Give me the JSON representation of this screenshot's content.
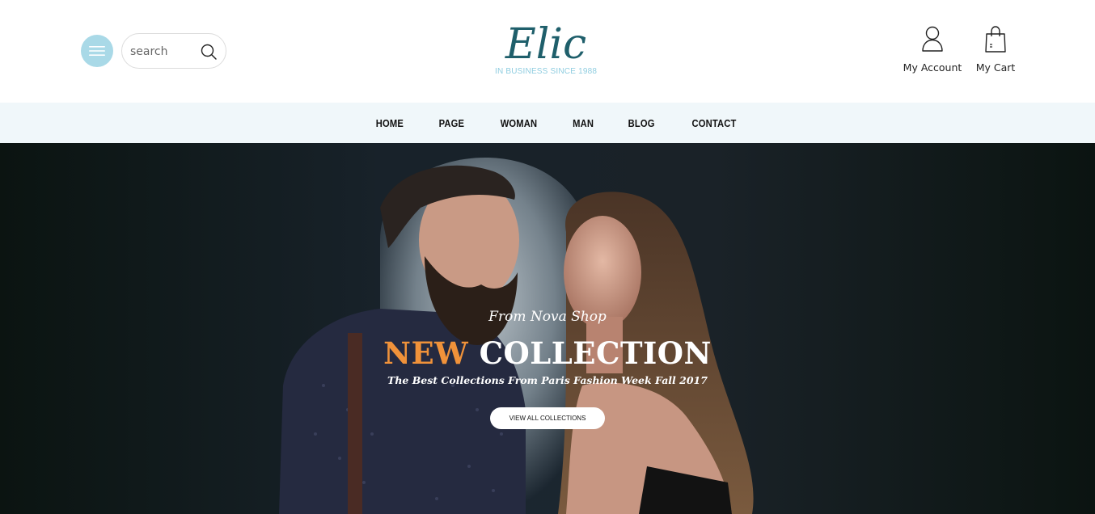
{
  "header": {
    "search": {
      "placeholder": "search"
    },
    "logo": {
      "wordmark": "Elic",
      "tagline": "IN BUSINESS SINCE 1988"
    },
    "account_label": "My Account",
    "cart_label": "My Cart",
    "icons": {
      "menu": "hamburger-icon",
      "search": "search-icon",
      "account": "user-icon",
      "cart": "shopping-bag-icon"
    }
  },
  "nav": {
    "items": [
      {
        "label": "HOME"
      },
      {
        "label": "PAGE"
      },
      {
        "label": "WOMAN"
      },
      {
        "label": "MAN"
      },
      {
        "label": "BLOG"
      },
      {
        "label": "CONTACT"
      }
    ]
  },
  "hero": {
    "pre_title": "From Nova Shop",
    "title_accent": "NEW",
    "title_rest": "COLLECTION",
    "subtitle": "The Best Collections From Paris Fashion Week Fall 2017",
    "button_label": "VIEW ALL COLLECTIONS",
    "image_subject": "bearded man and long-haired woman posing"
  },
  "colors": {
    "menu_button": "#a9d9e7",
    "logo_teal": "#1f5f6b",
    "logo_tagline": "#8fcde0",
    "nav_background": "#f0f7fa",
    "hero_accent": "#f0923a",
    "hero_background": "#0c1512"
  }
}
